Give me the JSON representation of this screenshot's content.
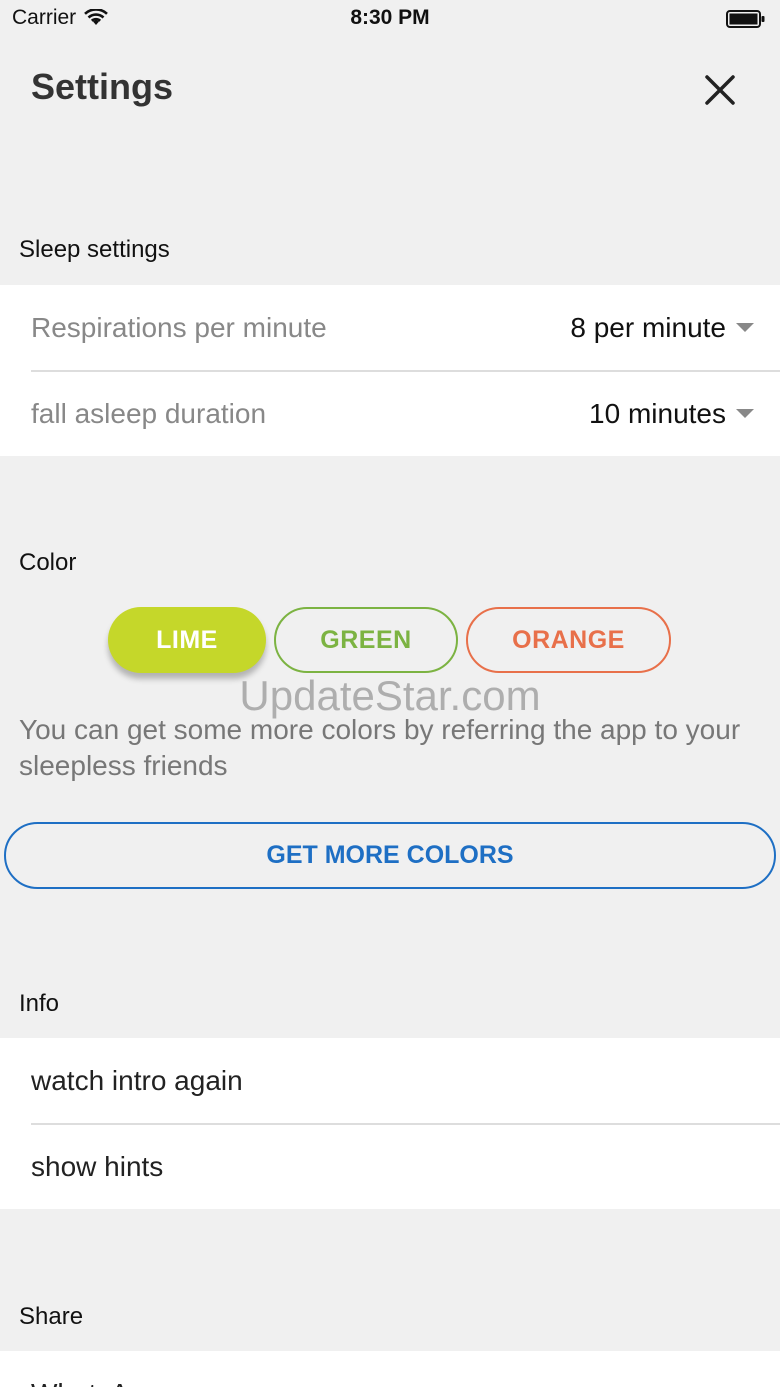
{
  "status_bar": {
    "carrier": "Carrier",
    "time": "8:30 PM"
  },
  "header": {
    "title": "Settings"
  },
  "sleep": {
    "section_label": "Sleep settings",
    "rows": [
      {
        "label": "Respirations per minute",
        "value": "8 per minute"
      },
      {
        "label": "fall asleep duration",
        "value": "10 minutes"
      }
    ]
  },
  "color": {
    "section_label": "Color",
    "options": [
      {
        "label": "LIME",
        "color": "#c5d72a",
        "selected": true
      },
      {
        "label": "GREEN",
        "color": "#7cb342",
        "selected": false
      },
      {
        "label": "ORANGE",
        "color": "#e8704a",
        "selected": false
      }
    ],
    "note": "You can get some more colors by referring the app to your sleepless friends",
    "more_button": "GET MORE COLORS"
  },
  "watermark": "UpdateStar.com",
  "info": {
    "section_label": "Info",
    "items": [
      {
        "label": "watch intro again"
      },
      {
        "label": "show hints"
      }
    ]
  },
  "share": {
    "section_label": "Share",
    "items": [
      {
        "label": "WhatsApp"
      }
    ]
  },
  "colors": {
    "background": "#f0f0f0",
    "accent_blue": "#1e6fc4"
  }
}
